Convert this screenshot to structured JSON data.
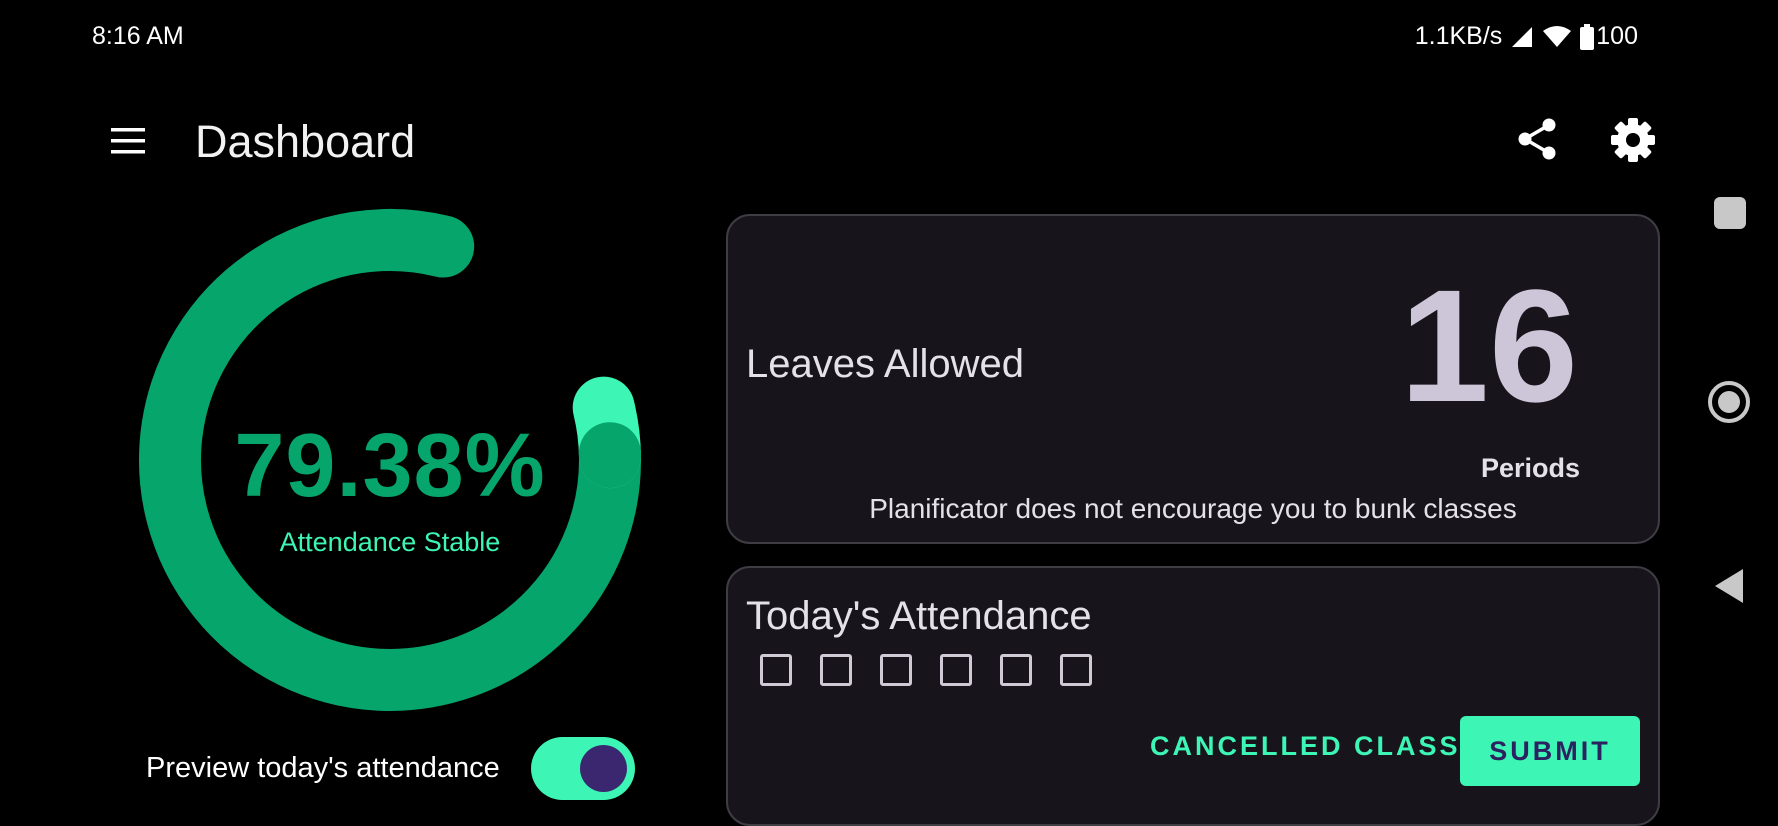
{
  "status_bar": {
    "time": "8:16 AM",
    "network_speed": "1.1KB/s",
    "battery": "100",
    "icons": [
      "signal-icon",
      "wifi-icon",
      "battery-icon"
    ]
  },
  "app_bar": {
    "title": "Dashboard",
    "icons": [
      "menu-icon",
      "share-icon",
      "gear-icon"
    ]
  },
  "attendance_gauge": {
    "percent_text": "79.38%",
    "percent_value": 79.38,
    "status": "Attendance Stable",
    "colors": {
      "arc": "#06a56c",
      "accent": "#3df5b4"
    }
  },
  "preview": {
    "label": "Preview today's attendance",
    "toggle_on": true
  },
  "leaves_card": {
    "title": "Leaves Allowed",
    "count": "16",
    "unit": "Periods",
    "note": "Planificator does not encourage you to bunk classes"
  },
  "today_card": {
    "title": "Today's Attendance",
    "checkboxes": [
      false,
      false,
      false,
      false,
      false,
      false
    ],
    "cancelled_label": "CANCELLED CLASS",
    "submit_label": "SUBMIT"
  },
  "system_nav": [
    "recents-icon",
    "home-icon",
    "back-icon"
  ],
  "colors": {
    "background": "#000000",
    "card": "#17141b",
    "accent": "#3df5b4",
    "primary_green": "#06a56c",
    "toggle_thumb": "#3a2770"
  }
}
